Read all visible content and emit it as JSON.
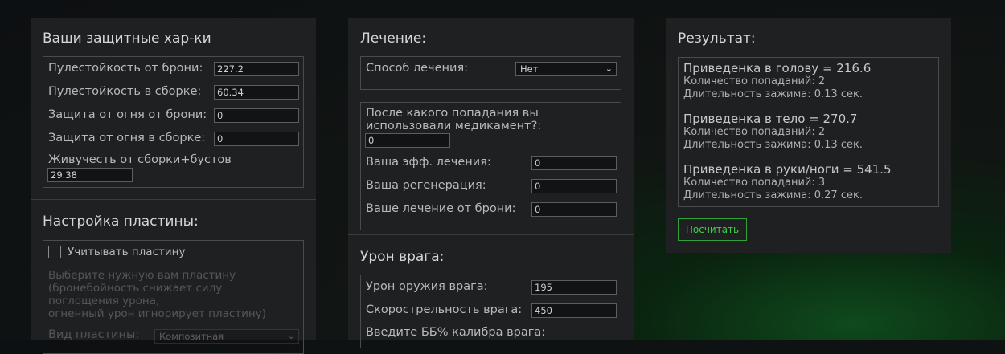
{
  "defense": {
    "title": "Ваши защитные хар-ки",
    "fields": [
      {
        "label": "Пулестойкость от брони:",
        "value": "227.2"
      },
      {
        "label": "Пулестойкость в сборке:",
        "value": "60.34"
      },
      {
        "label": "Защита от огня от брони:",
        "value": "0"
      },
      {
        "label": "Защита от огня в сборке:",
        "value": "0"
      }
    ],
    "vitality_label": "Живучесть от сборки+бустов",
    "vitality_value": "29.38"
  },
  "plate": {
    "title": "Настройка пластины:",
    "checkbox_label": "Учитывать пластину",
    "hint_lines": [
      "Выберите нужную вам пластину",
      "(бронебойность снижает силу",
      "поглощения урона,",
      "огненный урон игнорирует пластину)"
    ],
    "type_label": "Вид пластины:",
    "type_value": "Композитная"
  },
  "healing": {
    "title": "Лечение:",
    "method_label": "Способ лечения:",
    "method_value": "Нет",
    "after_hit_line1": "После какого попадания вы",
    "after_hit_line2": "использовали медикамент?:",
    "after_hit_value": "0",
    "fields": [
      {
        "label": "Ваша эфф. лечения:",
        "value": "0"
      },
      {
        "label": "Ваша регенерация:",
        "value": "0"
      },
      {
        "label": "Ваше лечение от брони:",
        "value": "0"
      }
    ]
  },
  "enemy": {
    "title": "Урон врага:",
    "fields": [
      {
        "label": "Урон оружия врага:",
        "value": "195"
      },
      {
        "label": "Скорострельность врага:",
        "value": "450"
      }
    ],
    "caliber_label": "Введите ББ% калибра врага:"
  },
  "result": {
    "title": "Результат:",
    "items": [
      {
        "head": "Приведенка в голову = 216.6",
        "hits": "Количество попаданий: 2",
        "duration": "Длительность зажима: 0.13 сек."
      },
      {
        "head": "Приведенка в тело = 270.7",
        "hits": "Количество попаданий: 2",
        "duration": "Длительность зажима: 0.13 сек."
      },
      {
        "head": "Приведенка в руки/ноги = 541.5",
        "hits": "Количество попаданий: 3",
        "duration": "Длительность зажима: 0.27 сек."
      }
    ],
    "button_label": "Посчитать"
  },
  "colors": {
    "accent": "#3ecf4b",
    "panel": "#1f2022",
    "border": "#4a4b4d"
  }
}
